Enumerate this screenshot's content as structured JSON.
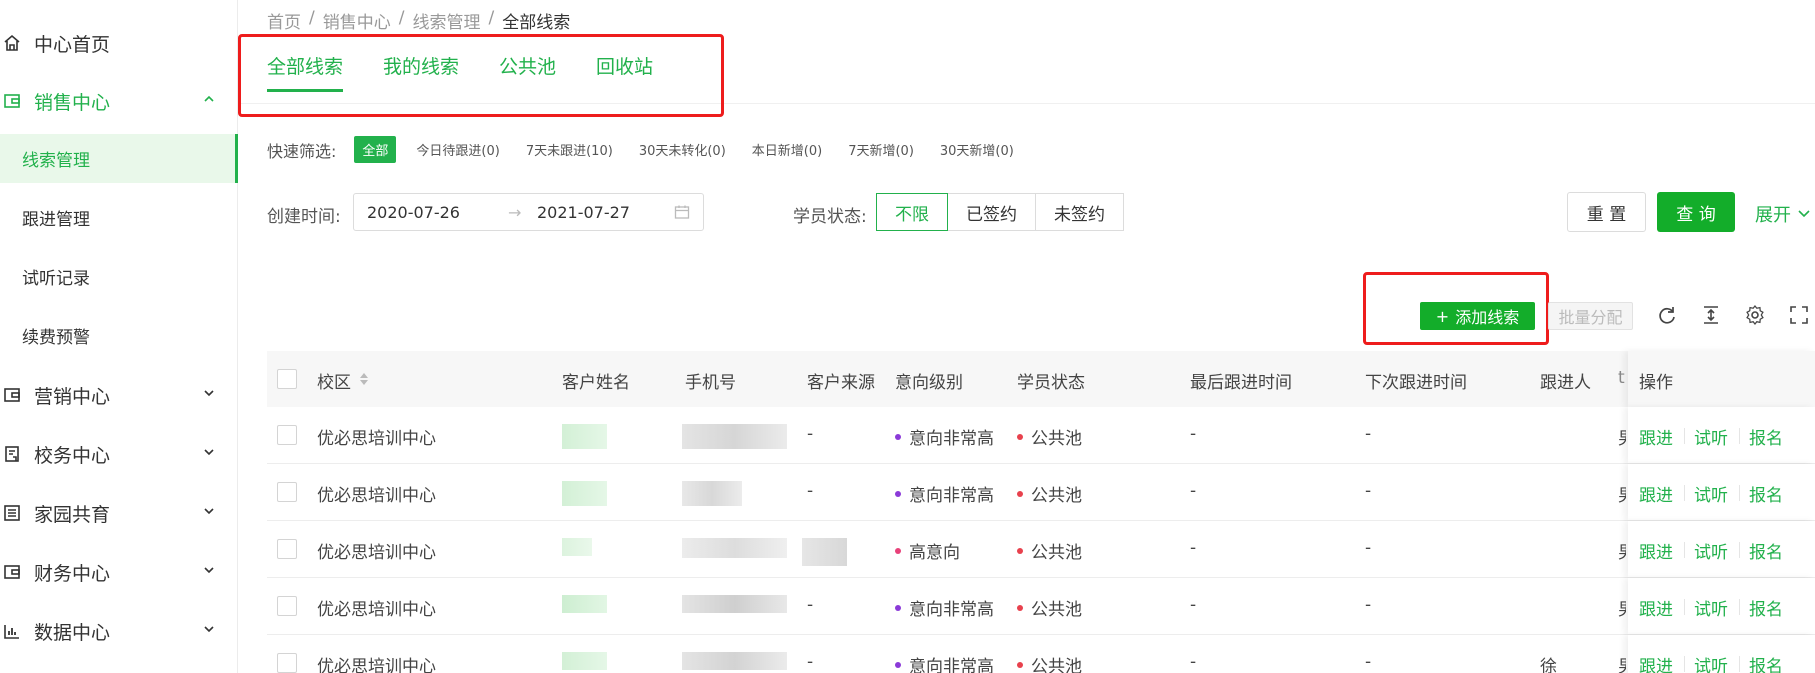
{
  "colors": {
    "accent": "#22b14c",
    "red_highlight": "#ee1c1c",
    "dot_purple": "#8b3ad8",
    "dot_red": "#e8414d",
    "dot_pink": "#e8417a"
  },
  "sidebar": {
    "home": {
      "label": "中心首页",
      "icon": "home-icon"
    },
    "sales": {
      "label": "销售中心",
      "icon": "wallet-icon"
    },
    "sub_items": [
      "线索管理",
      "跟进管理",
      "试听记录",
      "续费预警"
    ],
    "marketing": {
      "label": "营销中心",
      "icon": "wallet-icon"
    },
    "school": {
      "label": "校务中心",
      "icon": "clipboard-icon"
    },
    "family": {
      "label": "家园共育",
      "icon": "list-icon"
    },
    "finance": {
      "label": "财务中心",
      "icon": "wallet-icon"
    },
    "data": {
      "label": "数据中心",
      "icon": "bar-chart-icon"
    }
  },
  "breadcrumb": {
    "items": [
      "首页",
      "销售中心",
      "线索管理"
    ],
    "current": "全部线索",
    "sep": "/"
  },
  "tabs": [
    "全部线索",
    "我的线索",
    "公共池",
    "回收站"
  ],
  "quick_filter": {
    "label": "快速筛选:",
    "chips": [
      "全部",
      "今日待跟进(0)",
      "7天未跟进(10)",
      "30天未转化(0)",
      "本日新增(0)",
      "7天新增(0)",
      "30天新增(0)"
    ]
  },
  "filters": {
    "created_label": "创建时间:",
    "date_start": "2020-07-26",
    "date_end": "2021-07-27",
    "date_arrow": "→",
    "status_label": "学员状态:",
    "status_options": [
      "不限",
      "已签约",
      "未签约"
    ],
    "reset_label": "重 置",
    "query_label": "查 询",
    "expand_label": "展开"
  },
  "toolbar": {
    "add_label": "添加线索",
    "add_plus": "+",
    "batch_label": "批量分配"
  },
  "table": {
    "headers": [
      "校区",
      "客户姓名",
      "手机号",
      "客户来源",
      "意向级别",
      "学员状态",
      "最后跟进时间",
      "下次跟进时间",
      "跟进人",
      "操作"
    ],
    "header_fragment": "t",
    "rows": [
      {
        "campus": "优必思培训中心",
        "source": "-",
        "intent": "意向非常高",
        "status": "公共池",
        "last": "-",
        "next": "-",
        "owner": "",
        "frag": "男"
      },
      {
        "campus": "优必思培训中心",
        "source": "-",
        "intent": "意向非常高",
        "status": "公共池",
        "last": "-",
        "next": "-",
        "owner": "",
        "frag": "男"
      },
      {
        "campus": "优必思培训中心",
        "source": "",
        "intent": "高意向",
        "status": "公共池",
        "last": "-",
        "next": "-",
        "owner": "",
        "frag": "男"
      },
      {
        "campus": "优必思培训中心",
        "source": "-",
        "intent": "意向非常高",
        "status": "公共池",
        "last": "-",
        "next": "-",
        "owner": "",
        "frag": "男"
      },
      {
        "campus": "优必思培训中心",
        "source": "-",
        "intent": "意向非常高",
        "status": "公共池",
        "last": "-",
        "next": "-",
        "owner": "徐",
        "frag": "男"
      }
    ],
    "actions": [
      "跟进",
      "试听",
      "报名"
    ]
  }
}
